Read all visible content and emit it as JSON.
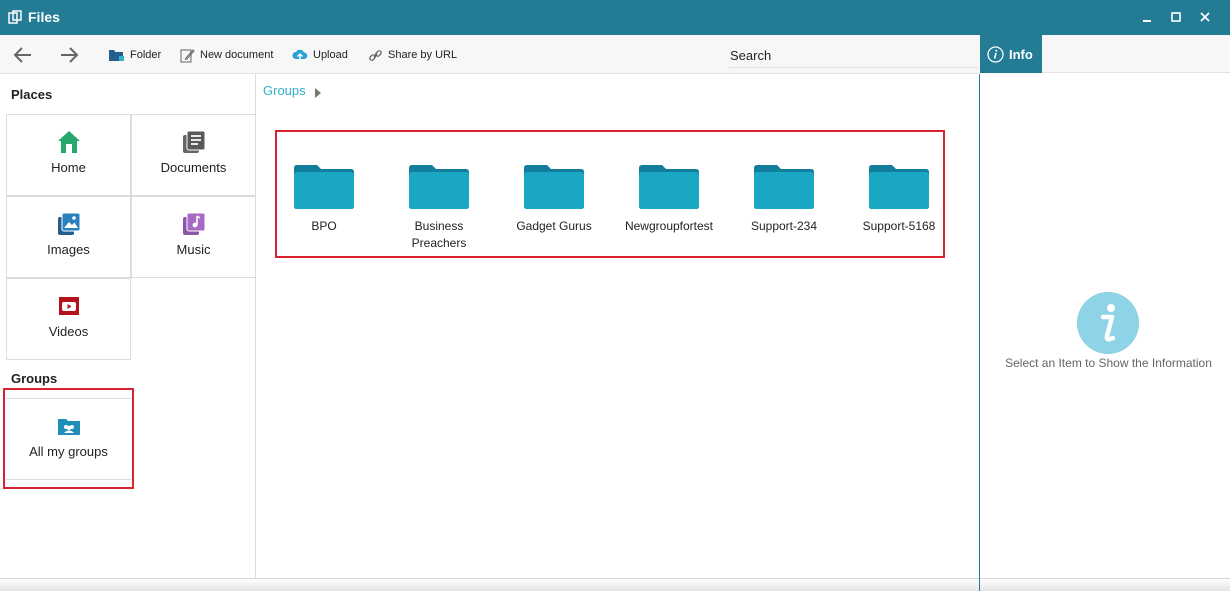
{
  "window": {
    "title": "Files"
  },
  "toolbar": {
    "folder_label": "Folder",
    "new_document_label": "New document",
    "upload_label": "Upload",
    "share_label": "Share by URL",
    "search_placeholder": "Search"
  },
  "info": {
    "tab_label": "Info",
    "empty_message": "Select an Item to Show the Information"
  },
  "sidebar": {
    "places_title": "Places",
    "places": [
      {
        "label": "Home",
        "icon": "home-icon"
      },
      {
        "label": "Documents",
        "icon": "documents-icon"
      },
      {
        "label": "Images",
        "icon": "images-icon"
      },
      {
        "label": "Music",
        "icon": "music-icon"
      },
      {
        "label": "Videos",
        "icon": "videos-icon"
      }
    ],
    "groups_title": "Groups",
    "groups": [
      {
        "label": "All my groups",
        "icon": "group-folder-icon"
      }
    ]
  },
  "breadcrumb": {
    "current": "Groups"
  },
  "folders": [
    {
      "name": "BPO"
    },
    {
      "name": "Business Preachers"
    },
    {
      "name": "Gadget Gurus"
    },
    {
      "name": "Newgroupfortest"
    },
    {
      "name": "Support-234"
    },
    {
      "name": "Support-5168"
    }
  ],
  "colors": {
    "accent": "#237c94",
    "highlight": "#d9232e",
    "folder": "#1aa7c3",
    "breadcrumb": "#2fb1c8"
  }
}
